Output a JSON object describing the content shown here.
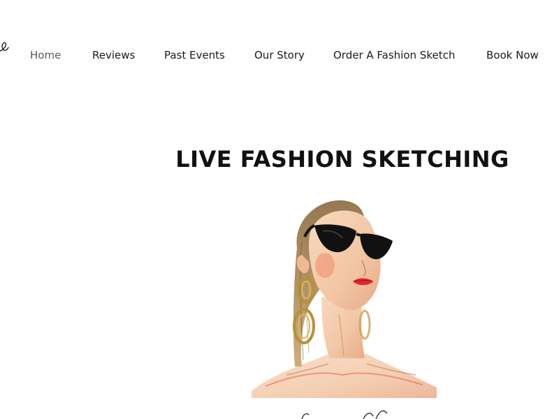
{
  "nav": {
    "items": [
      {
        "label": "Home",
        "active": true
      },
      {
        "label": "Reviews",
        "active": false
      },
      {
        "label": "Past Events",
        "active": false
      },
      {
        "label": "Our Story",
        "active": false
      },
      {
        "label": "Order A Fashion Sketch",
        "active": false
      },
      {
        "label": "Book Now",
        "active": false
      }
    ]
  },
  "hero": {
    "title": "LIVE FASHION SKETCHING"
  },
  "colors": {
    "text": "#1a1a1a",
    "nav_active": "#5a5a5a",
    "lips": "#e0262b",
    "earring_gold": "#b8903a"
  },
  "icons": {
    "logo": "script-logo-fragment",
    "illustration": "fashion-sketch-woman-sunglasses"
  }
}
